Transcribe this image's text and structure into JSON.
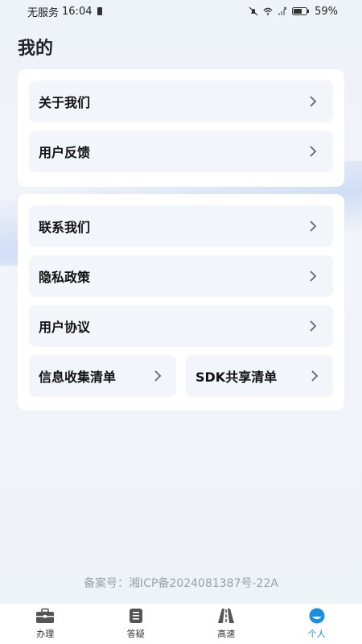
{
  "status_bar": {
    "carrier": "无服务",
    "time": "16:04",
    "battery": "59%"
  },
  "page": {
    "title": "我的"
  },
  "card_one": {
    "items": [
      {
        "label": "关于我们"
      },
      {
        "label": "用户反馈"
      }
    ]
  },
  "card_two": {
    "items": [
      {
        "label": "联系我们"
      },
      {
        "label": "隐私政策"
      },
      {
        "label": "用户协议"
      }
    ],
    "split": [
      {
        "label": "信息收集清单"
      },
      {
        "label": "SDK共享清单"
      }
    ]
  },
  "footer": {
    "icp": "备案号：湘ICP备2024081387号-22A"
  },
  "tabs": [
    {
      "label": "办理",
      "icon": "briefcase-icon"
    },
    {
      "label": "答疑",
      "icon": "document-list-icon"
    },
    {
      "label": "高速",
      "icon": "highway-icon"
    },
    {
      "label": "个人",
      "icon": "person-icon",
      "active": true
    }
  ],
  "colors": {
    "accent": "#1a8fe0",
    "card_row_bg": "#f2f6fb"
  }
}
